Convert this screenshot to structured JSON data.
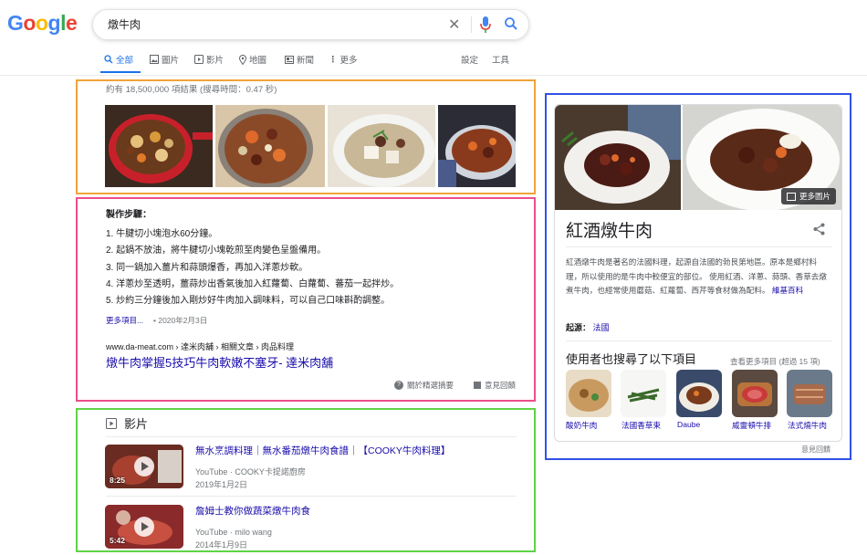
{
  "logo": {
    "letters": [
      "G",
      "o",
      "o",
      "g",
      "l",
      "e"
    ],
    "colors": [
      "#4285f4",
      "#ea4335",
      "#fbbc05",
      "#4285f4",
      "#34a853",
      "#ea4335"
    ]
  },
  "search": {
    "query": "燉牛肉"
  },
  "tabs": {
    "all": "全部",
    "images": "圖片",
    "videos": "影片",
    "maps": "地圖",
    "news": "新聞",
    "more": "更多",
    "settings": "設定",
    "tools": "工具"
  },
  "results": {
    "stats": "約有 18,500,000 項結果 (搜尋時間：0.47 秒)",
    "snippet": {
      "title": "製作步驟：",
      "steps": [
        "1. 牛腱切小塊泡水60分鐘。",
        "2. 起鍋不放油，將牛腱切小塊乾煎至肉變色呈盤備用。",
        "3. 同一鍋加入薑片和蒜頭爆香，再加入洋蔥炒軟。",
        "4. 洋蔥炒至透明，薑蒜炒出香氣後加入紅蘿蔔、白蘿蔔、蕃茄一起拌炒。",
        "5. 炒約三分鐘後加入剛炒好牛肉加入調味料，可以自己口味斟酌調整。"
      ],
      "more_link": "更多項目...",
      "date": "• 2020年2月3日",
      "cite": "www.da-meat.com › 達米肉舖 › 相關文章 › 肉品料理",
      "result_title": "燉牛肉掌握5技巧牛肉軟嫩不塞牙- 達米肉舖",
      "about": "關於精選摘要",
      "feedback": "意見回饋"
    },
    "videos": {
      "header": "影片",
      "items": [
        {
          "title": "無水烹調料理｜無水番茄燉牛肉食譜｜【COOKY牛肉料理】",
          "source": "YouTube · COOKY卡提諾廚房",
          "date": "2019年1月2日",
          "duration": "8:25"
        },
        {
          "title": "詹姆士教你做蔬菜燉牛肉食",
          "source": "YouTube · milo wang",
          "date": "2014年1月9日",
          "duration": "5:42"
        }
      ]
    }
  },
  "knowledge_panel": {
    "more_images": "更多圖片",
    "title": "紅酒燉牛肉",
    "description": "紅酒燉牛肉是著名的法國料理，起源自法國的勃艮第地區。原本是鄉村料理，所以使用的是牛肉中較便宜的部位。 使用紅酒、洋蔥、蒜頭、香草去燉煮牛肉，也經常使用蘑菇、紅蘿蔔、西芹等食材做為配料。",
    "wiki_link": "維基百科",
    "source_label": "起源：",
    "source_value": "法國",
    "also_searched": "使用者也搜尋了以下項目",
    "see_more": "查看更多項目 (超過 15 項)",
    "items": [
      "酸奶牛肉",
      "法國香草束",
      "Daube",
      "威靈頓牛排",
      "法式燒牛肉"
    ],
    "feedback": "意見回饋"
  }
}
